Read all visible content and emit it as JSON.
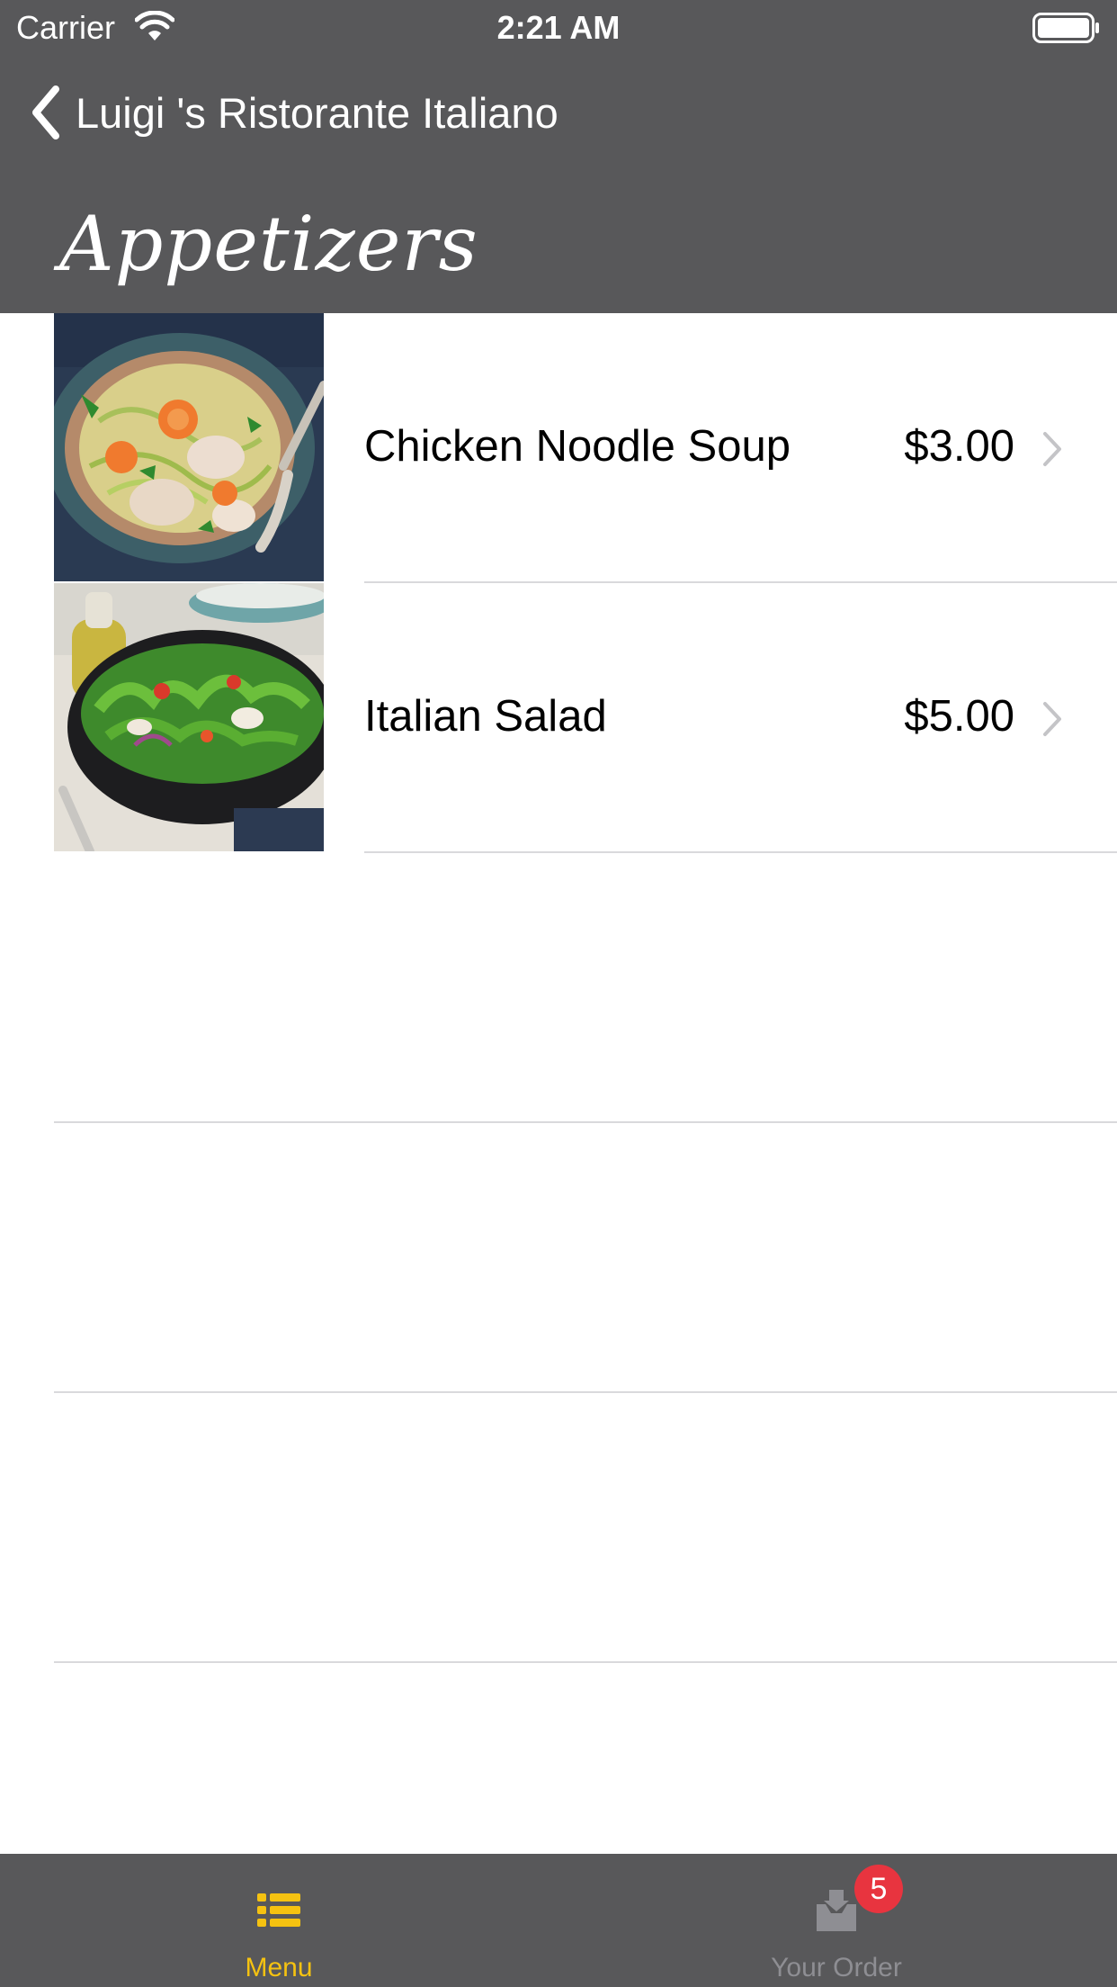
{
  "status_bar": {
    "carrier": "Carrier",
    "time": "2:21 AM"
  },
  "nav": {
    "back_title": "Luigi 's Ristorante Italiano"
  },
  "section": {
    "title": "Appetizers"
  },
  "menu_items": [
    {
      "name": "Chicken Noodle Soup",
      "price": "$3.00"
    },
    {
      "name": "Italian Salad",
      "price": "$5.00"
    }
  ],
  "tabs": [
    {
      "label": "Menu",
      "color": "#f5c211",
      "icon": "list-icon"
    },
    {
      "label": "Your Order",
      "color": "#8e8e93",
      "icon": "inbox-icon",
      "badge": "5"
    }
  ],
  "colors": {
    "bars": "#58585a",
    "accent": "#f5c211",
    "badge": "#e8343f"
  }
}
